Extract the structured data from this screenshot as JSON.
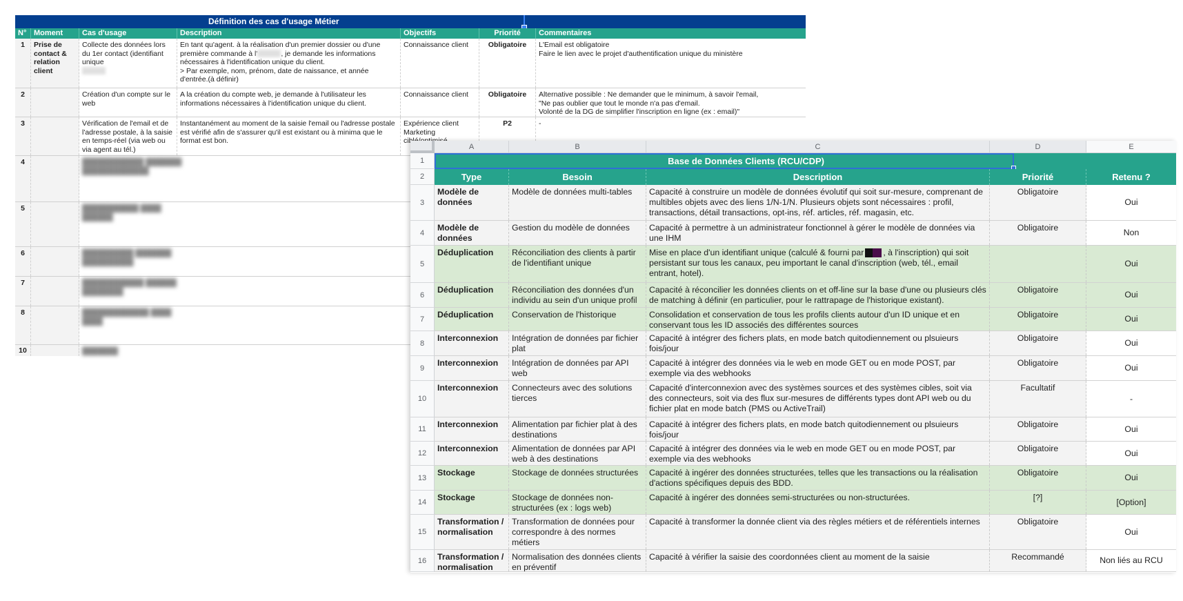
{
  "back_sheet": {
    "title": "Définition des cas d'usage Métier",
    "columns": [
      "N°",
      "Moment",
      "Cas d'usage",
      "Description",
      "Objectifs",
      "Priorité",
      "Commentaires"
    ],
    "rows": [
      {
        "num": "1",
        "moment": "Prise de contact & relation client",
        "usecase": "Collecte des données lors du 1er contact (identifiant unique",
        "description_1": "En tant qu'agent. à la réalisation d'un premier dossier ou d'une première commande à l'",
        "description_2": ", je demande les informations nécessaires à l'identification unique du client.",
        "description_3": "> Par exemple, nom, prénom, date de naissance, et année d'entrée.(à définir)",
        "objectifs": "Connaissance client",
        "priorite": "Obligatoire",
        "commentaires_1": "L'Email est obligatoire",
        "commentaires_2": "Faire le lien avec le projet d'authentification unique du ministère"
      },
      {
        "num": "2",
        "moment": "",
        "usecase": "Création d'un compte sur le web",
        "description": "A la création du compte web, je demande à l'utilisateur les informations nécessaires à l'identification unique du client.",
        "objectifs": "Connaissance client",
        "priorite": "Obligatoire",
        "commentaires_1": "Alternative possible : Ne demander que le minimum, à savoir l'email,",
        "commentaires_2": "\"Ne pas oublier que tout le monde n'a pas d'email.",
        "commentaires_3": "Volonté de la DG de simplifier l'inscription en ligne (ex : email)\""
      },
      {
        "num": "3",
        "moment": "",
        "usecase": "Vérification de l'email et de l'adresse postale, à la saisie en temps-réel (via web ou via agent au tél.)",
        "description": "Instantanément au moment de la saisie l'email ou l'adresse postale est vérifié afin de s'assurer qu'il est existant ou à minima que le format est bon.",
        "objectifs_1": "Expérience client",
        "objectifs_2": "Marketing ciblé/optimisé",
        "priorite": "P2",
        "commentaires": "-"
      }
    ],
    "blurred_row_numbers": [
      "4",
      "5",
      "6",
      "7",
      "8",
      "10"
    ]
  },
  "front_sheet": {
    "column_letters": [
      "A",
      "B",
      "C",
      "D",
      "E"
    ],
    "title": "Base de Données Clients (RCU/CDP)",
    "headers": [
      "Type",
      "Besoin",
      "Description",
      "Priorité",
      "Retenu ?"
    ],
    "rows": [
      {
        "n": "3",
        "type": "Modèle de données",
        "besoin": "Modèle de données multi-tables",
        "description": "Capacité à construire un modèle de données évolutif qui soit sur-mesure, comprenant de multibles objets avec des liens 1/N-1/N. Plusieurs objets sont nécessaires : profil, transactions, détail transactions, opt-ins, réf. articles, réf. magasin, etc.",
        "priorite": "Obligatoire",
        "retenu": "Oui",
        "color": "grey"
      },
      {
        "n": "4",
        "type": "Modèle de données",
        "besoin": "Gestion du modèle de données",
        "description": "Capacité à permettre à un administrateur fonctionnel à gérer le modèle de données via une IHM",
        "priorite": "Obligatoire",
        "retenu": "Non",
        "color": "grey"
      },
      {
        "n": "5",
        "type": "Déduplication",
        "besoin": "Réconciliation des clients à partir de l'identifiant unique",
        "description_a": "Mise en place d'un identifiant unique (calculé & fourni par",
        "description_b": ", à l'inscription) qui soit persistant sur tous les canaux, peu important le canal d'inscription (web, tél., email entrant, hotel).",
        "priorite": "",
        "retenu": "Oui",
        "color": "green"
      },
      {
        "n": "6",
        "type": "Déduplication",
        "besoin": "Réconciliation des données d'un individu au sein d'un unique profil",
        "description": "Capacité à réconcilier les données clients on et off-line sur la base d'une ou plusieurs clés de matching à définir (en particulier, pour le rattrapage de l'historique existant).",
        "priorite": "Obligatoire",
        "retenu": "Oui",
        "color": "green"
      },
      {
        "n": "7",
        "type": "Déduplication",
        "besoin": "Conservation de l'historique",
        "description": "Consolidation et conservation de tous les profils clients autour d'un ID unique et en conservant tous les ID associés des différentes sources",
        "priorite": "Obligatoire",
        "retenu": "Oui",
        "color": "green"
      },
      {
        "n": "8",
        "type": "Interconnexion",
        "besoin": "Intégration de données par fichier plat",
        "description": "Capacité à intégrer des fichers plats, en mode batch quitodiennement ou plsuieurs fois/jour",
        "priorite": "Obligatoire",
        "retenu": "Oui",
        "color": "grey"
      },
      {
        "n": "9",
        "type": "Interconnexion",
        "besoin": "Intégration de données par API web",
        "description": "Capacité à intégrer des données via le web en mode GET ou en mode POST, par exemple via des webhooks",
        "priorite": "Obligatoire",
        "retenu": "Oui",
        "color": "grey"
      },
      {
        "n": "10",
        "type": "Interconnexion",
        "besoin": "Connecteurs avec des solutions tierces",
        "description": "Capacité d'interconnexion avec des systèmes sources et des systèmes cibles, soit via des connecteurs, soit via des flux sur-mesures de différents types dont API web ou du fichier plat en mode batch (PMS ou ActiveTrail)",
        "priorite": "Facultatif",
        "retenu": "-",
        "color": "grey"
      },
      {
        "n": "11",
        "type": "Interconnexion",
        "besoin": "Alimentation par fichier plat à des destinations",
        "description": "Capacité à intégrer des fichers plats, en mode batch quitodiennement ou plsuieurs fois/jour",
        "priorite": "Obligatoire",
        "retenu": "Oui",
        "color": "grey"
      },
      {
        "n": "12",
        "type": "Interconnexion",
        "besoin": "Alimentation de données par API web à des destinations",
        "description": "Capacité à intégrer des données via le web en mode GET ou en mode POST, par exemple via des webhooks",
        "priorite": "Obligatoire",
        "retenu": "Oui",
        "color": "grey"
      },
      {
        "n": "13",
        "type": "Stockage",
        "besoin": "Stockage de données structurées",
        "description": "Capacité à ingérer des données structurées, telles que les transactions ou la réalisation d'actions spécifiques depuis des BDD.",
        "priorite": "Obligatoire",
        "retenu": "Oui",
        "color": "green"
      },
      {
        "n": "14",
        "type": "Stockage",
        "besoin": "Stockage de données non-structurées (ex : logs web)",
        "description": "Capacité à ingérer des données semi-structurées ou non-structurées.",
        "priorite": "[?]",
        "retenu": "[Option]",
        "color": "green"
      },
      {
        "n": "15",
        "type": "Transformation / normalisation",
        "besoin": "Transformation de données pour correspondre à des normes métiers",
        "description": "Capacité à transformer la donnée client via des règles métiers et de référentiels internes",
        "priorite": "Obligatoire",
        "retenu": "Oui",
        "color": "grey"
      },
      {
        "n": "16",
        "type": "Transformation / normalisation",
        "besoin": "Normalisation des données clients en préventif",
        "description": "Capacité à vérifier la saisie des coordonnées client au moment de la saisie",
        "priorite": "Recommandé",
        "retenu": "Non liés au RCU",
        "color": "grey"
      }
    ]
  }
}
